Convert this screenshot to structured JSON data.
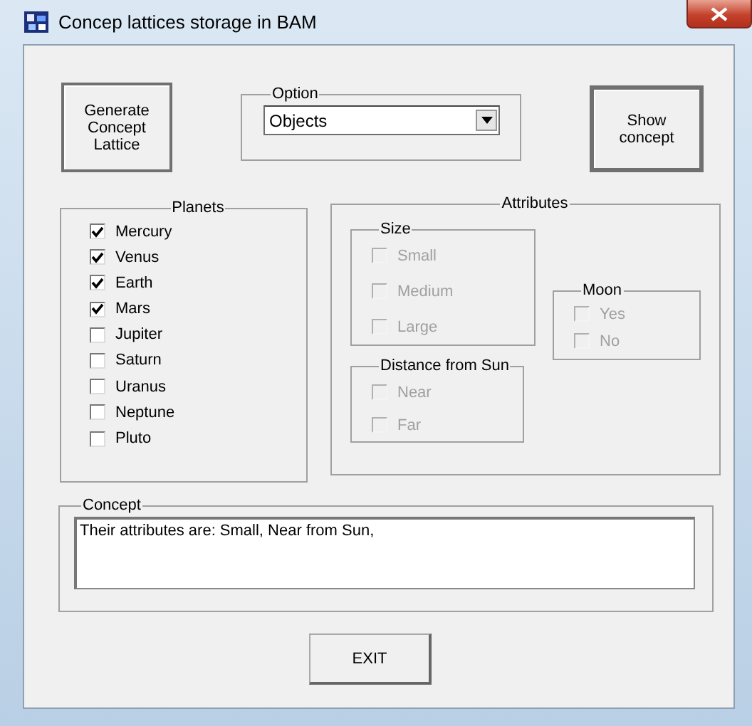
{
  "window": {
    "title": "Concep lattices storage in BAM"
  },
  "buttons": {
    "generate": "Generate Concept Lattice",
    "show": "Show concept",
    "exit": "EXIT"
  },
  "option": {
    "label": "Option",
    "value": "Objects"
  },
  "planets": {
    "label": "Planets",
    "items": [
      {
        "label": "Mercury",
        "checked": true
      },
      {
        "label": "Venus",
        "checked": true
      },
      {
        "label": "Earth",
        "checked": true
      },
      {
        "label": "Mars",
        "checked": true
      },
      {
        "label": "Jupiter",
        "checked": false
      },
      {
        "label": "Saturn",
        "checked": false
      },
      {
        "label": "Uranus",
        "checked": false
      },
      {
        "label": "Neptune",
        "checked": false
      },
      {
        "label": "Pluto",
        "checked": false
      }
    ]
  },
  "attributes": {
    "label": "Attributes",
    "groups": [
      {
        "kind": "size",
        "label": "Size",
        "items": [
          {
            "label": "Small",
            "checked": false,
            "disabled": true
          },
          {
            "label": "Medium",
            "checked": false,
            "disabled": true
          },
          {
            "label": "Large",
            "checked": false,
            "disabled": true
          }
        ]
      },
      {
        "kind": "distance",
        "label": "Distance from Sun",
        "items": [
          {
            "label": "Near",
            "checked": false,
            "disabled": true
          },
          {
            "label": "Far",
            "checked": false,
            "disabled": true
          }
        ]
      },
      {
        "kind": "moon",
        "label": "Moon",
        "items": [
          {
            "label": "Yes",
            "checked": false,
            "disabled": true
          },
          {
            "label": "No",
            "checked": false,
            "disabled": true
          }
        ]
      }
    ]
  },
  "concept": {
    "label": "Concept",
    "value": "Their attributes are: Small, Near from Sun,"
  }
}
